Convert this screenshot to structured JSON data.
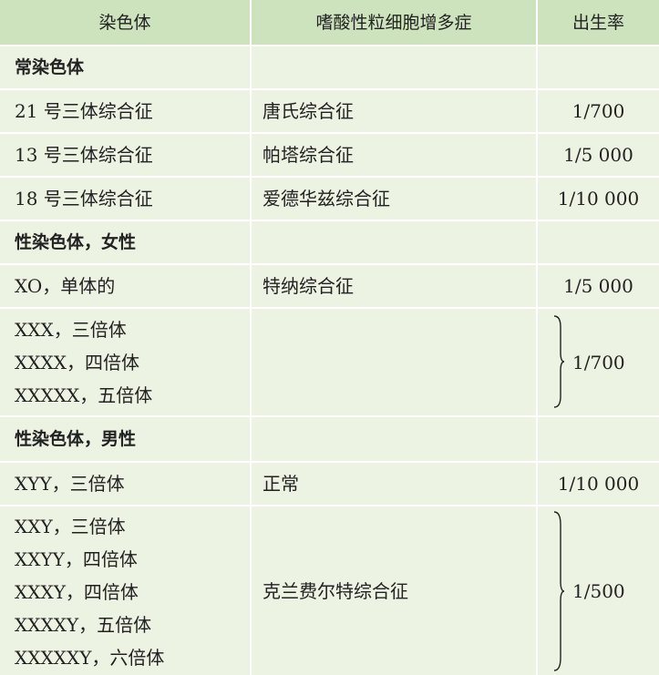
{
  "header": {
    "col1": "染色体",
    "col2": "嗜酸性粒细胞增多症",
    "col3": "出生率"
  },
  "groups": {
    "autosome": "常染色体",
    "sex_female": "性染色体，女性",
    "sex_male": "性染色体，男性"
  },
  "rows": {
    "r21": {
      "chromosome": "21 号三体综合征",
      "syndrome": "唐氏综合征",
      "rate": "1/700"
    },
    "r13": {
      "chromosome": "13 号三体综合征",
      "syndrome": "帕塔综合征",
      "rate": "1/5 000"
    },
    "r18": {
      "chromosome": "18 号三体综合征",
      "syndrome": "爱德华兹综合征",
      "rate": "1/10 000"
    },
    "xo": {
      "chromosome": "XO，单体的",
      "syndrome": "特纳综合征",
      "rate": "1/5 000"
    },
    "xxx_group": {
      "lines": [
        "XXX，三倍体",
        "XXXX，四倍体",
        "XXXXX，五倍体"
      ],
      "syndrome": "",
      "rate": "1/700"
    },
    "xyy": {
      "chromosome": "XYY，三倍体",
      "syndrome": "正常",
      "rate": "1/10 000"
    },
    "xxy_group": {
      "lines": [
        "XXY，三倍体",
        "XXYY，四倍体",
        "XXXY，四倍体",
        "XXXXY，五倍体",
        "XXXXXY，六倍体"
      ],
      "syndrome": "克兰费尔特综合征",
      "rate": "1/500"
    }
  },
  "colors": {
    "header_bg": "#cde3bd",
    "row_bg": "#ecf3e2",
    "grid": "#ffffff",
    "text": "#222222"
  }
}
